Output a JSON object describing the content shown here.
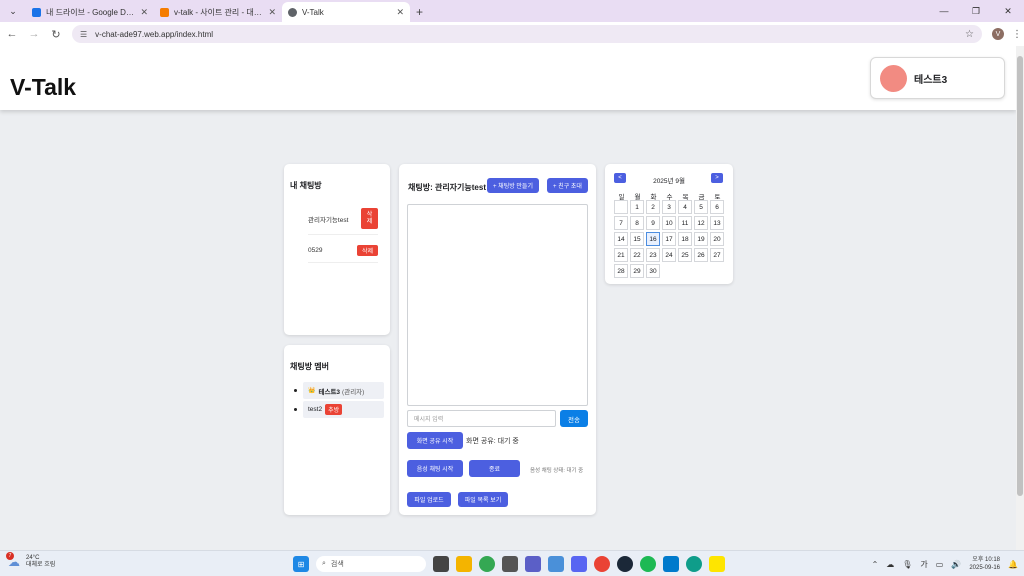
{
  "browser": {
    "tabs": [
      {
        "title": "내 드라이브 - Google Drive",
        "color": "#1a73e8",
        "active": false
      },
      {
        "title": "v-talk - 사이트 관리 - 대시보드",
        "color": "#f57c00",
        "active": false
      },
      {
        "title": "V-Talk",
        "color": "#5f6368",
        "active": true
      }
    ],
    "url": "v-chat-ade97.web.app/index.html",
    "profile_initial": "V"
  },
  "header": {
    "brand": "V-Talk",
    "user_name": "테스트3",
    "avatar_color": "#f28b82"
  },
  "my_rooms": {
    "title": "내 채팅방",
    "rooms": [
      {
        "name": "관리자기능test",
        "delete_label": "삭\n제"
      },
      {
        "name": "0529",
        "delete_label": "삭제"
      }
    ]
  },
  "members": {
    "title": "채팅방 멤버",
    "list": [
      {
        "name": "테스트3",
        "role": "(관리자)",
        "crown": "👑"
      },
      {
        "name": "test2",
        "badge": "추방"
      }
    ]
  },
  "chat": {
    "title": "채팅방: 관리자기능test",
    "create_room_label": "+ 채팅방 만들기",
    "invite_label": "+ 친구 초대",
    "input_placeholder": "메시지 입력",
    "send_label": "전송",
    "screen_share_label": "화면 공유 시작",
    "screen_share_status": "화면 공유: 대기 중",
    "voice_start_label": "음성 채팅 시작",
    "voice_end_label": "종료",
    "voice_status": "음성 채팅 상태: 대기 중",
    "file_upload_label": "파일 업로드",
    "file_list_label": "파일 목록 보기"
  },
  "calendar": {
    "prev_label": "<",
    "next_label": ">",
    "month_label": "2025년 9월",
    "weekdays": [
      "일",
      "월",
      "화",
      "수",
      "목",
      "금",
      "토"
    ],
    "leading_blank": 1,
    "days_in_month": 30,
    "today": 16
  },
  "taskbar": {
    "temp": "24°C",
    "weather_desc": "대체로 흐림",
    "weather_badge": "7",
    "search_placeholder": "검색",
    "time": "오후 10:18",
    "date": "2025-09-16",
    "ime": "가"
  },
  "colors": {
    "accent": "#4c5fe0",
    "danger": "#ea4335",
    "send": "#0b7fe6"
  }
}
